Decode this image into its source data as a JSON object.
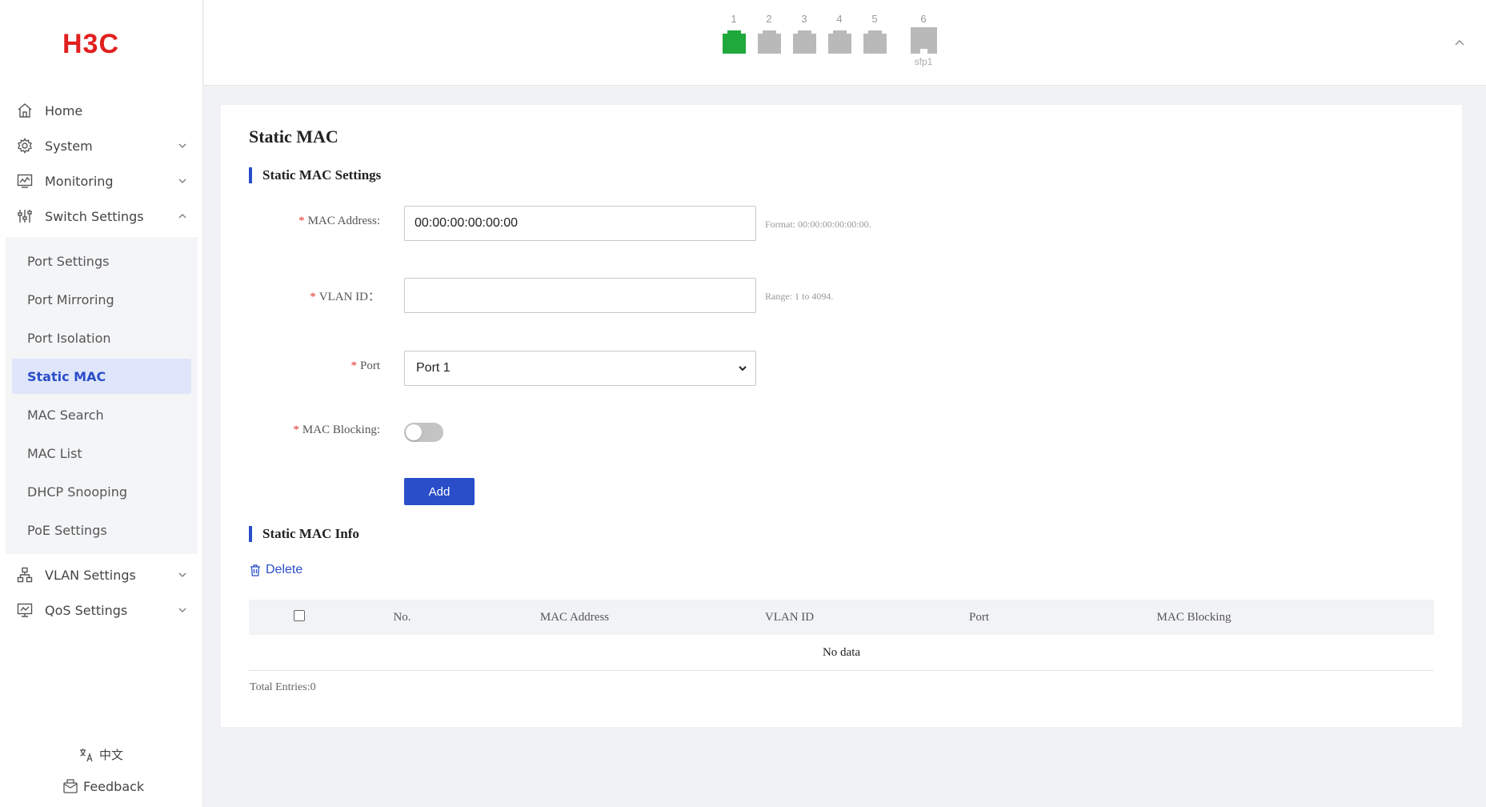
{
  "brand": {
    "logo_text": "H3C",
    "logo_color": "#e0201e"
  },
  "sidebar": {
    "items": [
      {
        "label": "Home",
        "icon": "home-icon",
        "expandable": false
      },
      {
        "label": "System",
        "icon": "gear-icon",
        "expandable": true,
        "expanded": false
      },
      {
        "label": "Monitoring",
        "icon": "monitor-chart-icon",
        "expandable": true,
        "expanded": false
      },
      {
        "label": "Switch Settings",
        "icon": "sliders-icon",
        "expandable": true,
        "expanded": true
      }
    ],
    "submenu": [
      {
        "label": "Port Settings",
        "active": false
      },
      {
        "label": "Port Mirroring",
        "active": false
      },
      {
        "label": "Port Isolation",
        "active": false
      },
      {
        "label": "Static MAC",
        "active": true
      },
      {
        "label": "MAC Search",
        "active": false
      },
      {
        "label": "MAC List",
        "active": false
      },
      {
        "label": "DHCP Snooping",
        "active": false
      },
      {
        "label": "PoE Settings",
        "active": false
      }
    ],
    "items_after": [
      {
        "label": "VLAN Settings",
        "icon": "network-tree-icon",
        "expandable": true
      },
      {
        "label": "QoS Settings",
        "icon": "qos-icon",
        "expandable": true
      }
    ],
    "language_label": "中文",
    "feedback_label": "Feedback"
  },
  "ports": [
    {
      "num": "1",
      "status": "up",
      "color": "#1fa83b"
    },
    {
      "num": "2",
      "status": "down",
      "color": "#b9b9b9"
    },
    {
      "num": "3",
      "status": "down",
      "color": "#b9b9b9"
    },
    {
      "num": "4",
      "status": "down",
      "color": "#b9b9b9"
    },
    {
      "num": "5",
      "status": "down",
      "color": "#b9b9b9"
    },
    {
      "num": "6",
      "status": "down",
      "color": "#b9b9b9",
      "sublabel": "sfp1"
    }
  ],
  "page": {
    "title": "Static MAC",
    "settings_section": "Static MAC Settings",
    "info_section": "Static MAC Info"
  },
  "form": {
    "mac_label": "MAC Address:",
    "mac_value": "00:00:00:00:00:00",
    "mac_hint": "Format: 00:00:00:00:00:00.",
    "vlan_label": "VLAN ID：",
    "vlan_value": "",
    "vlan_hint": "Range: 1 to 4094.",
    "port_label": "Port",
    "port_value": "Port 1",
    "blocking_label": "MAC Blocking:",
    "blocking_on": false,
    "add_label": "Add",
    "required_mark": "*"
  },
  "table": {
    "delete_label": "Delete",
    "columns": [
      "No.",
      "MAC Address",
      "VLAN ID",
      "Port",
      "MAC Blocking"
    ],
    "empty_text": "No data",
    "total_label": "Total Entries:0"
  },
  "colors": {
    "accent": "#2a4ec9",
    "required": "#e0332f",
    "active_bg": "#dfe6fb"
  }
}
